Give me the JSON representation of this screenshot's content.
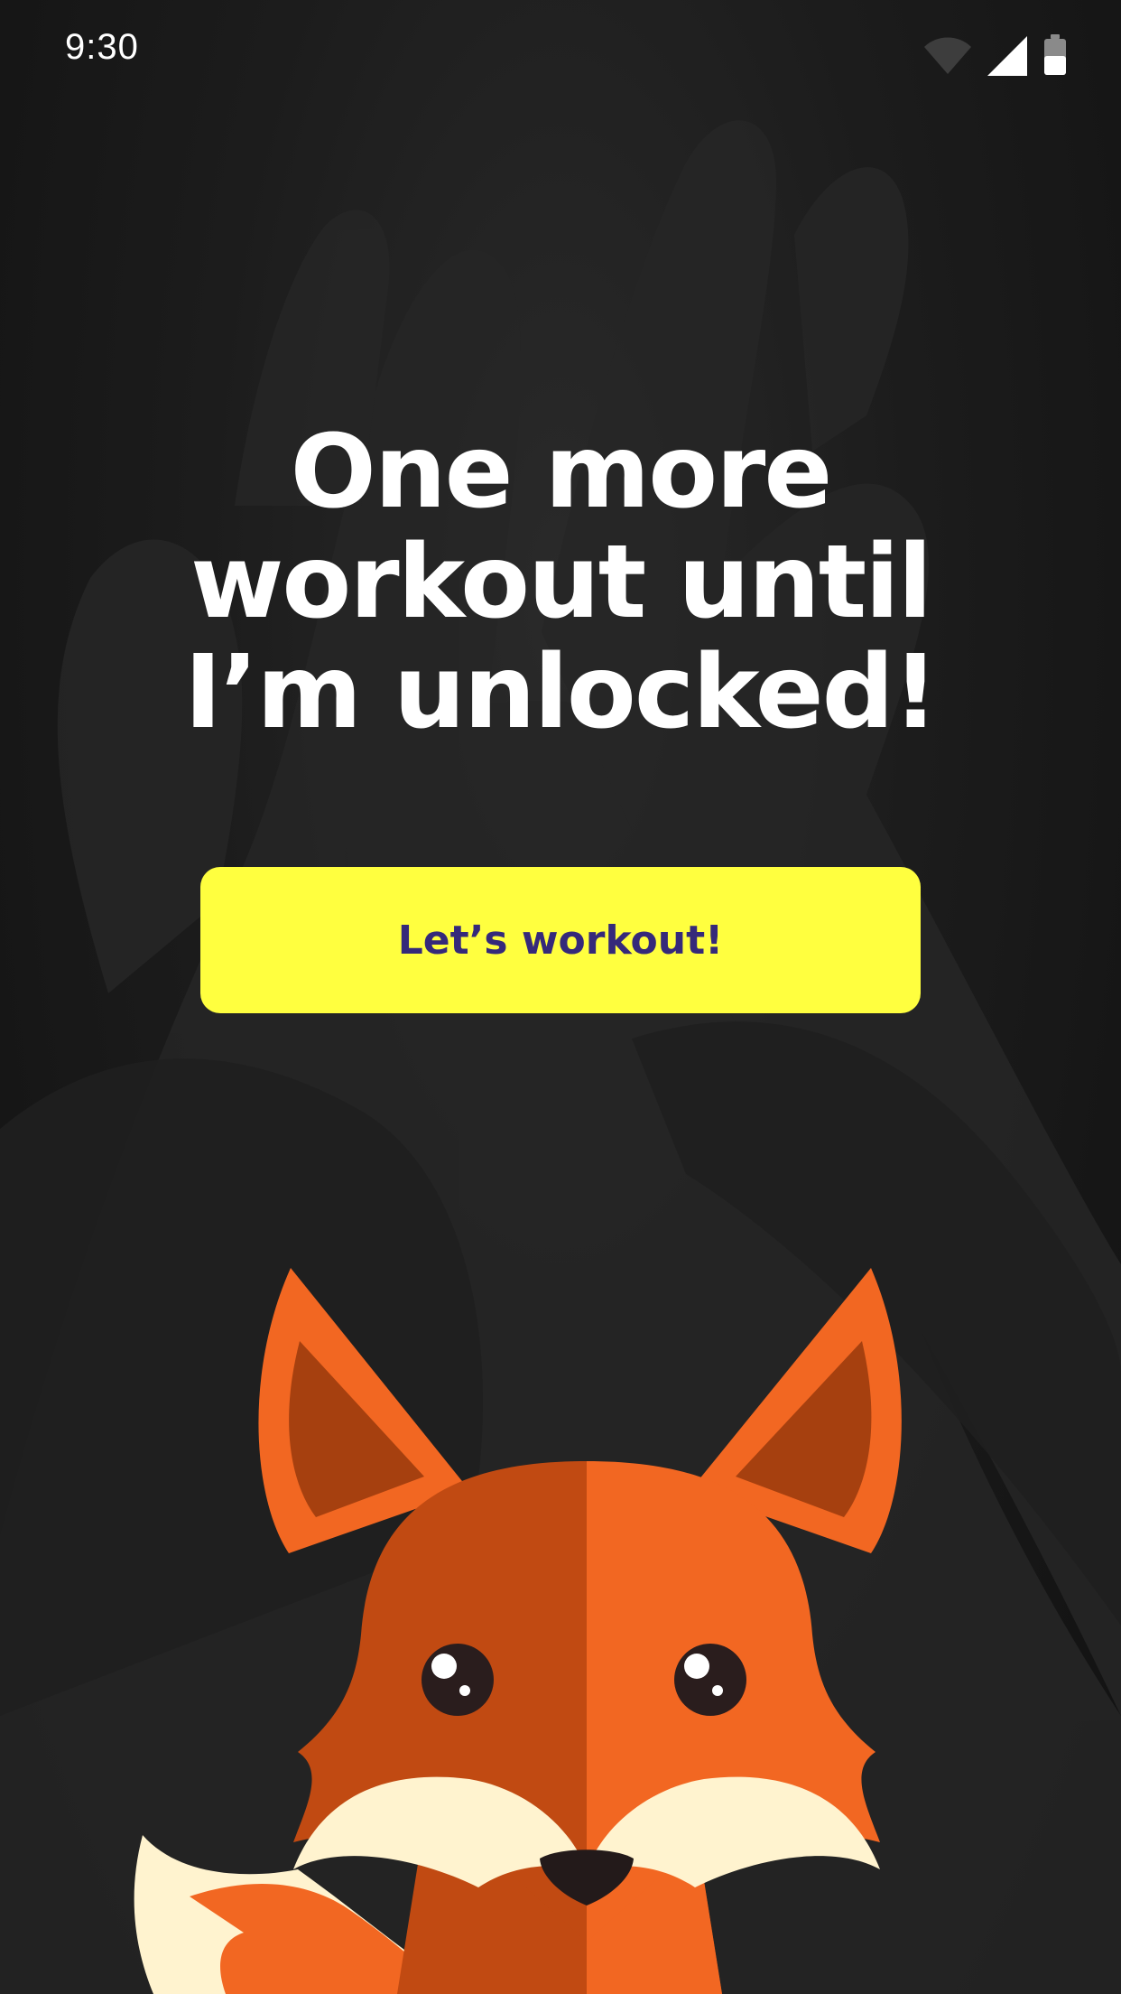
{
  "status_bar": {
    "time": "9:30",
    "icons": [
      "wifi-icon",
      "cellular-signal-icon",
      "battery-icon"
    ]
  },
  "main": {
    "headline_lines": [
      "One more",
      "workout until",
      "I’m unlocked!"
    ],
    "cta_label": "Let’s workout!"
  },
  "mascot": {
    "name": "fox-mascot-illustration"
  },
  "colors": {
    "background": "#1c1c1c",
    "headline": "#ffffff",
    "button_bg": "#ffff3f",
    "button_text": "#35297a",
    "fox_orange": "#f26722",
    "fox_dark_orange": "#c14a12",
    "fox_inner_ear": "#a6400f",
    "fox_cream": "#fff3cf"
  }
}
